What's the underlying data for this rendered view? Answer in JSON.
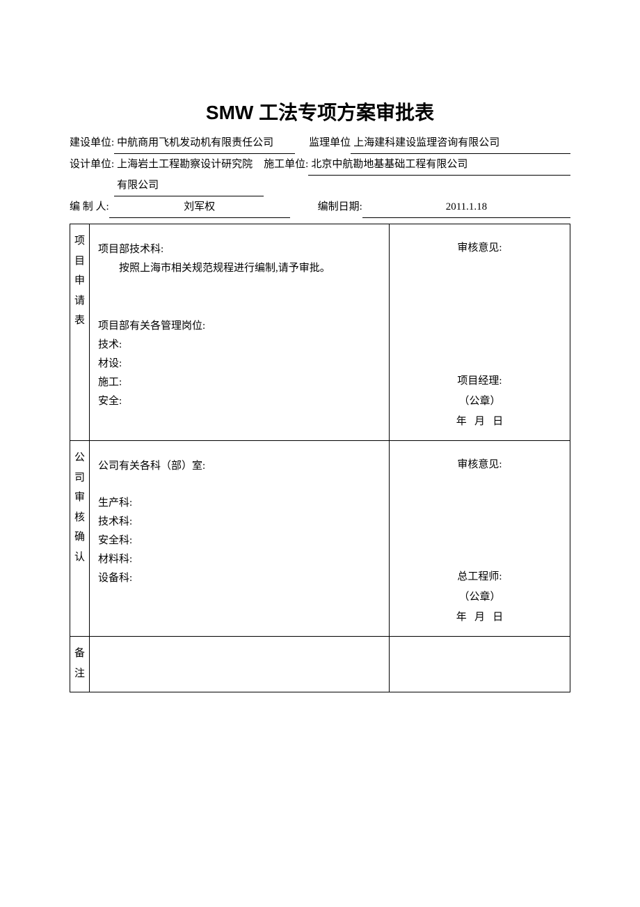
{
  "title": "SMW 工法专项方案审批表",
  "header": {
    "construction_unit_label": "建设单位:",
    "construction_unit_value": "中航商用飞机发动机有限责任公司",
    "supervision_unit_label": "监理单位",
    "supervision_unit_value": "上海建科建设监理咨询有限公司",
    "design_unit_label": "设计单位:",
    "design_unit_value": "上海岩土工程勘察设计研究院有限公司",
    "contractor_unit_label": "施工单位:",
    "contractor_unit_value": "北京中航勘地基基础工程有限公司",
    "compiler_label": "编 制 人:",
    "compiler_value": "刘军权",
    "compile_date_label": "编制日期:",
    "compile_date_value": "2011.1.18"
  },
  "section1": {
    "vlabel": "项目申请表",
    "tech_dept": "项目部技术科:",
    "tech_note": "按照上海市相关规范规程进行编制,请予审批。",
    "positions_title": "项目部有关各管理岗位:",
    "p_tech": "技术:",
    "p_material": "材设:",
    "p_construct": "施工:",
    "p_safety": "安全:",
    "review_title": "审核意见:",
    "pm_label": "项目经理:",
    "seal": "（公章）",
    "date": "年   月   日"
  },
  "section2": {
    "vlabel": "公司审核确认",
    "dept_title": "公司有关各科（部）室:",
    "d_prod": "生产科:",
    "d_tech": "技术科:",
    "d_safe": "安全科:",
    "d_mat": "材料科:",
    "d_equip": "设备科:",
    "review_title": "审核意见:",
    "chief_label": "总工程师:",
    "seal": "（公章）",
    "date": "年   月   日"
  },
  "section3": {
    "vlabel": "备注"
  }
}
